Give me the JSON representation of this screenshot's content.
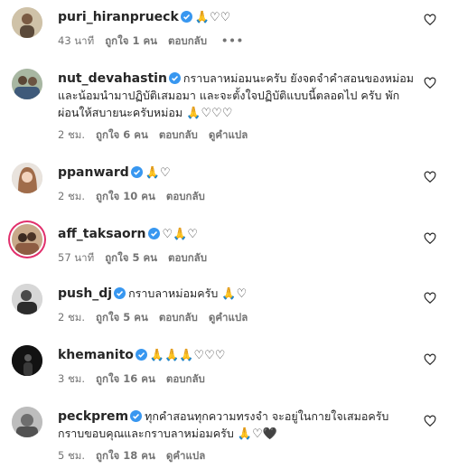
{
  "comments": [
    {
      "username": "puri_hiranprueck",
      "verified": true,
      "text": "",
      "emoji": "🙏♡♡",
      "time": "43 นาที",
      "likes": "ถูกใจ 1 คน",
      "reply": "ตอบกลับ",
      "translate": "",
      "more": "•••"
    },
    {
      "username": "nut_devahastin",
      "verified": true,
      "text": "กราบลาหม่อมนะครับ ยังจดจำคำสอนของหม่อม และน้อมนำมาปฏิบัติเสมอมา และจะตั้งใจปฏิบัติแบบนี้ตลอดไป ครับ พักผ่อนให้สบายนะครับหม่อม",
      "emoji": "🙏♡♡♡",
      "time": "2 ชม.",
      "likes": "ถูกใจ 6 คน",
      "reply": "ตอบกลับ",
      "translate": "ดูคำแปล",
      "more": ""
    },
    {
      "username": "ppanward",
      "verified": true,
      "text": "",
      "emoji": "🙏♡",
      "time": "2 ชม.",
      "likes": "ถูกใจ 10 คน",
      "reply": "ตอบกลับ",
      "translate": "",
      "more": ""
    },
    {
      "username": "aff_taksaorn",
      "verified": true,
      "text": "",
      "emoji": "♡🙏♡",
      "time": "57 นาที",
      "likes": "ถูกใจ 5 คน",
      "reply": "ตอบกลับ",
      "translate": "",
      "more": ""
    },
    {
      "username": "push_dj",
      "verified": true,
      "text": "กราบลาหม่อมครับ",
      "emoji": "🙏♡",
      "time": "2 ชม.",
      "likes": "ถูกใจ 5 คน",
      "reply": "ตอบกลับ",
      "translate": "ดูคำแปล",
      "more": ""
    },
    {
      "username": "khemanito",
      "verified": true,
      "text": "",
      "emoji": "🙏🙏🙏♡♡♡",
      "time": "3 ชม.",
      "likes": "ถูกใจ 16 คน",
      "reply": "ตอบกลับ",
      "translate": "",
      "more": ""
    },
    {
      "username": "peckprem",
      "verified": true,
      "text": "ทุกคำสอนทุกความทรงจำ จะอยู่ในกายใจเสมอครับ กราบขอบคุณและกราบลาหม่อมครับ",
      "emoji": "🙏♡🖤",
      "time": "5 ชม.",
      "likes": "ถูกใจ 18 คน",
      "reply": "ตอบกลับ",
      "translate": "ดูคำแปล",
      "more": ""
    }
  ],
  "colors": {
    "verified": "#3897f0",
    "text": "#262626",
    "meta": "#737373",
    "story_ring": "#e1306c"
  },
  "icons": {
    "like": "heart-outline-icon",
    "verified": "verified-badge-icon"
  }
}
